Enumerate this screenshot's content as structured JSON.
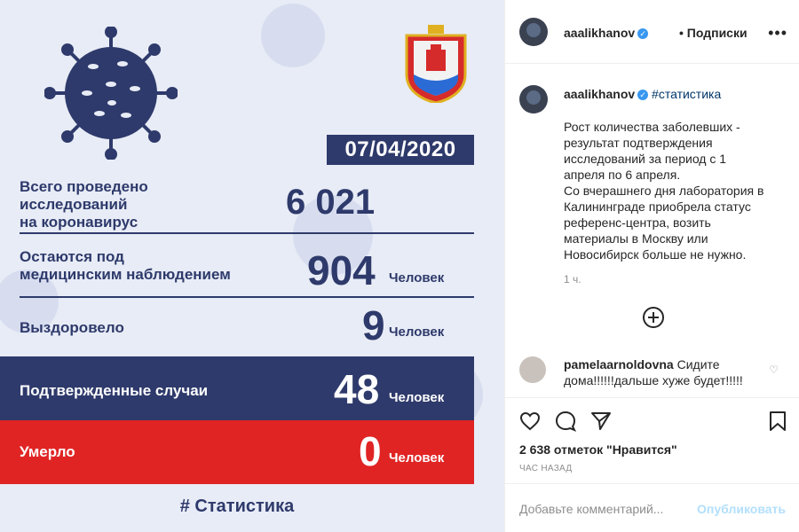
{
  "image": {
    "date": "07/04/2020",
    "stats": [
      {
        "label": "Всего проведено\nисследований\nна коронавирус",
        "value": "6 021",
        "unit": ""
      },
      {
        "label": "Остаются под\nмедицинским наблюдением",
        "value": "904",
        "unit": "Человек"
      },
      {
        "label": "Выздоровело",
        "value": "9",
        "unit": "Человек"
      }
    ],
    "confirmed": {
      "label": "Подтвержденные случаи",
      "value": "48",
      "unit": "Человек"
    },
    "died": {
      "label": "Умерло",
      "value": "0",
      "unit": "Человек"
    },
    "hashtag": "# Статистика",
    "colors": {
      "navy": "#2e3a6b",
      "red": "#e02424",
      "background": "#e8ecf6"
    }
  },
  "header": {
    "username": "aaalikhanov",
    "follow_text": "• Подписки",
    "more_icon": "more-horizontal-icon"
  },
  "caption": {
    "username": "aaalikhanov",
    "hashtag": "#статистика",
    "text": "Рост количества заболевших -\nрезультат подтверждения\nисследований за период с 1\nапреля по 6 апреля.\nСо вчерашнего дня лаборатория в\nКалининграде приобрела статус\nреференс-центра, возить\nматериалы в Москву или\nНовосибирск больше не нужно.",
    "time": "1 ч."
  },
  "comment": {
    "username": "pamelaarnoldovna",
    "text": "Сидите дома!!!!!!дальше хуже будет!!!!!"
  },
  "actions": {
    "likes": "2 638 отметок \"Нравится\"",
    "ago": "ЧАС НАЗАД",
    "add_comment_placeholder": "Добавьте комментарий...",
    "publish": "Опубликовать"
  }
}
